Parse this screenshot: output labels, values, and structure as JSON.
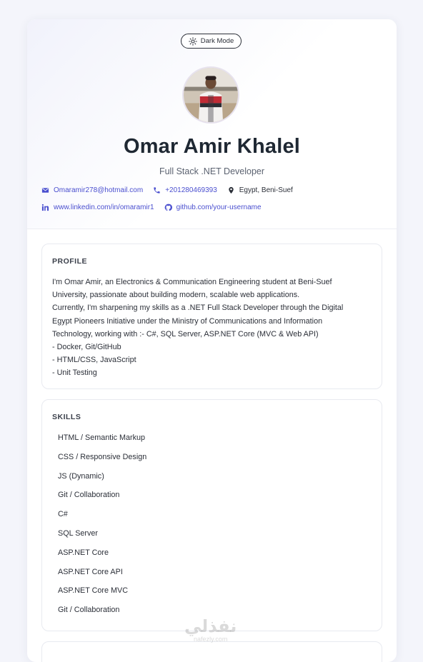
{
  "theme_toggle": {
    "label": "Dark Mode",
    "icon": "sun-icon"
  },
  "profile_header": {
    "name": "Omar Amir Khalel",
    "title": "Full Stack .NET Developer"
  },
  "contacts": {
    "email": "Omaramir278@hotmail.com",
    "phone": "+201280469393",
    "location": "Egypt, Beni-Suef",
    "linkedin": "www.linkedin.com/in/omaramir1",
    "github": "github.com/your-username"
  },
  "profile": {
    "heading": "PROFILE",
    "lines": [
      "I'm Omar Amir, an Electronics & Communication Engineering student at Beni-Suef",
      "University, passionate about building modern, scalable web applications.",
      "Currently, I'm sharpening my skills as a .NET Full Stack Developer through the Digital",
      "Egypt Pioneers Initiative under the Ministry of Communications and Information",
      "Technology, working with :- C#, SQL Server, ASP.NET Core (MVC & Web API)",
      "- Docker, Git/GitHub",
      "- HTML/CSS, JavaScript",
      "- Unit Testing"
    ]
  },
  "skills": {
    "heading": "SKILLS",
    "items": [
      "HTML / Semantic Markup",
      "CSS / Responsive Design",
      "JS (Dynamic)",
      "Git / Collaboration",
      "C#",
      "SQL Server",
      "ASP.NET Core",
      "ASP.NET Core API",
      "ASP.NET Core MVC",
      "Git / Collaboration"
    ]
  },
  "watermark": {
    "text": "نفذلي",
    "site": "nafezly.com"
  },
  "colors": {
    "accent": "#4a4fcf",
    "text": "#1f2833",
    "background": "#f4f5fb"
  }
}
